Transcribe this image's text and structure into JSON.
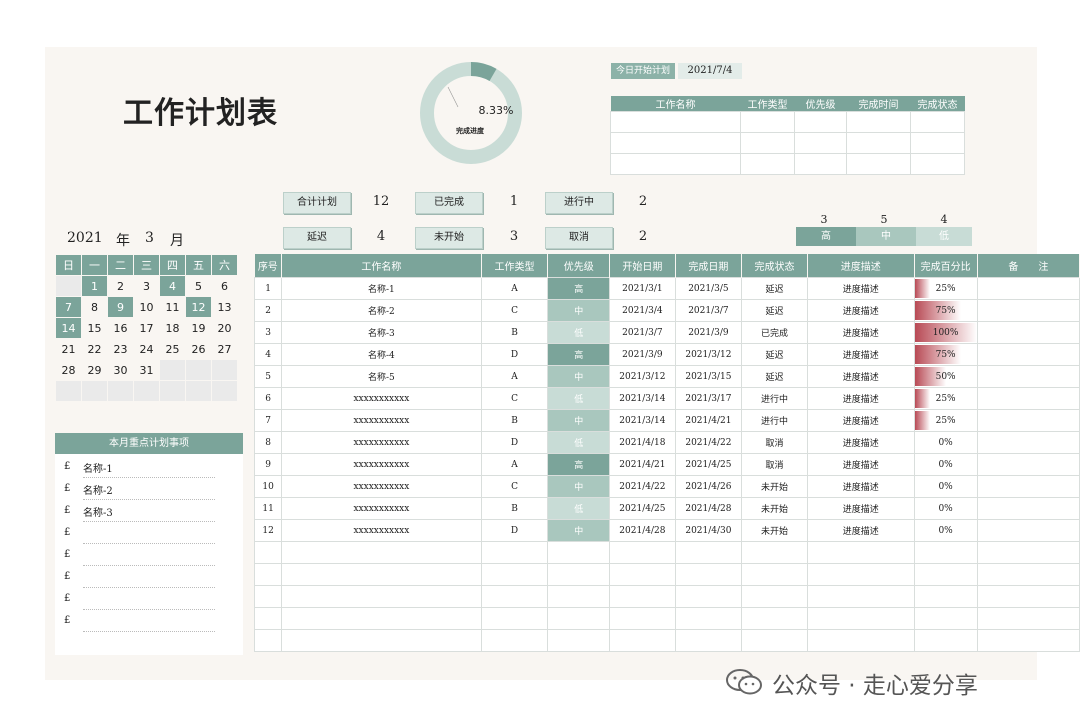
{
  "title": "工作计划表",
  "progress": {
    "percent_label": "8.33%",
    "value": 0.0833,
    "label": "完成进度"
  },
  "today": {
    "label": "今日开始计划",
    "date": "2021/7/4"
  },
  "today_table": {
    "headers": [
      "工作名称",
      "工作类型",
      "优先级",
      "完成时间",
      "完成状态"
    ]
  },
  "stats": {
    "total": {
      "label": "合计计划",
      "value": "12"
    },
    "done": {
      "label": "已完成",
      "value": "1"
    },
    "ongoing": {
      "label": "进行中",
      "value": "2"
    },
    "delay": {
      "label": "延迟",
      "value": "4"
    },
    "notstart": {
      "label": "未开始",
      "value": "3"
    },
    "cancel": {
      "label": "取消",
      "value": "2"
    }
  },
  "priority_summary": {
    "high": {
      "label": "高",
      "count": "3"
    },
    "mid": {
      "label": "中",
      "count": "5"
    },
    "low": {
      "label": "低",
      "count": "4"
    }
  },
  "calendar": {
    "year": "2021",
    "year_unit": "年",
    "month": "3",
    "month_unit": "月",
    "weekdays": [
      "日",
      "一",
      "二",
      "三",
      "四",
      "五",
      "六"
    ],
    "weeks": [
      [
        "",
        "1",
        "2",
        "3",
        "4",
        "5",
        "6"
      ],
      [
        "7",
        "8",
        "9",
        "10",
        "11",
        "12",
        "13"
      ],
      [
        "14",
        "15",
        "16",
        "17",
        "18",
        "19",
        "20"
      ],
      [
        "21",
        "22",
        "23",
        "24",
        "25",
        "26",
        "27"
      ],
      [
        "28",
        "29",
        "30",
        "31",
        "",
        "",
        ""
      ],
      [
        "",
        "",
        "",
        "",
        "",
        "",
        ""
      ]
    ],
    "highlighted": [
      "1",
      "4",
      "7",
      "9",
      "12",
      "14"
    ]
  },
  "focus": {
    "title": "本月重点计划事项",
    "bullet": "£",
    "items": [
      "名称-1",
      "名称-2",
      "名称-3",
      "",
      "",
      "",
      "",
      ""
    ]
  },
  "table": {
    "headers": [
      "序号",
      "工作名称",
      "工作类型",
      "优先级",
      "开始日期",
      "完成日期",
      "完成状态",
      "进度描述",
      "完成百分比",
      "备　　注"
    ],
    "rows": [
      {
        "no": "1",
        "name": "名称-1",
        "type": "A",
        "priority": "高",
        "start": "2021/3/1",
        "end": "2021/3/5",
        "status": "延迟",
        "desc": "进度描述",
        "pct": "25%",
        "pct_value": 0.25
      },
      {
        "no": "2",
        "name": "名称-2",
        "type": "C",
        "priority": "中",
        "start": "2021/3/4",
        "end": "2021/3/7",
        "status": "延迟",
        "desc": "进度描述",
        "pct": "75%",
        "pct_value": 0.75
      },
      {
        "no": "3",
        "name": "名称-3",
        "type": "B",
        "priority": "低",
        "start": "2021/3/7",
        "end": "2021/3/9",
        "status": "已完成",
        "desc": "进度描述",
        "pct": "100%",
        "pct_value": 1.0
      },
      {
        "no": "4",
        "name": "名称-4",
        "type": "D",
        "priority": "高",
        "start": "2021/3/9",
        "end": "2021/3/12",
        "status": "延迟",
        "desc": "进度描述",
        "pct": "75%",
        "pct_value": 0.75
      },
      {
        "no": "5",
        "name": "名称-5",
        "type": "A",
        "priority": "中",
        "start": "2021/3/12",
        "end": "2021/3/15",
        "status": "延迟",
        "desc": "进度描述",
        "pct": "50%",
        "pct_value": 0.5
      },
      {
        "no": "6",
        "name": "xxxxxxxxxxx",
        "type": "C",
        "priority": "低",
        "start": "2021/3/14",
        "end": "2021/3/17",
        "status": "进行中",
        "desc": "进度描述",
        "pct": "25%",
        "pct_value": 0.25
      },
      {
        "no": "7",
        "name": "xxxxxxxxxxx",
        "type": "B",
        "priority": "中",
        "start": "2021/3/14",
        "end": "2021/4/21",
        "status": "进行中",
        "desc": "进度描述",
        "pct": "25%",
        "pct_value": 0.25
      },
      {
        "no": "8",
        "name": "xxxxxxxxxxx",
        "type": "D",
        "priority": "低",
        "start": "2021/4/18",
        "end": "2021/4/22",
        "status": "取消",
        "desc": "进度描述",
        "pct": "0%",
        "pct_value": 0
      },
      {
        "no": "9",
        "name": "xxxxxxxxxxx",
        "type": "A",
        "priority": "高",
        "start": "2021/4/21",
        "end": "2021/4/25",
        "status": "取消",
        "desc": "进度描述",
        "pct": "0%",
        "pct_value": 0
      },
      {
        "no": "10",
        "name": "xxxxxxxxxxx",
        "type": "C",
        "priority": "中",
        "start": "2021/4/22",
        "end": "2021/4/26",
        "status": "未开始",
        "desc": "进度描述",
        "pct": "0%",
        "pct_value": 0
      },
      {
        "no": "11",
        "name": "xxxxxxxxxxx",
        "type": "B",
        "priority": "低",
        "start": "2021/4/25",
        "end": "2021/4/28",
        "status": "未开始",
        "desc": "进度描述",
        "pct": "0%",
        "pct_value": 0
      },
      {
        "no": "12",
        "name": "xxxxxxxxxxx",
        "type": "D",
        "priority": "中",
        "start": "2021/4/28",
        "end": "2021/4/30",
        "status": "未开始",
        "desc": "进度描述",
        "pct": "0%",
        "pct_value": 0
      }
    ],
    "empty_rows": 5
  },
  "watermark": "公众号 · 走心爱分享",
  "colors": {
    "accent": "#7ba49a",
    "accent_light": "#a9c7be",
    "accent_lighter": "#c8dcd6",
    "bar": "#b84a55"
  }
}
